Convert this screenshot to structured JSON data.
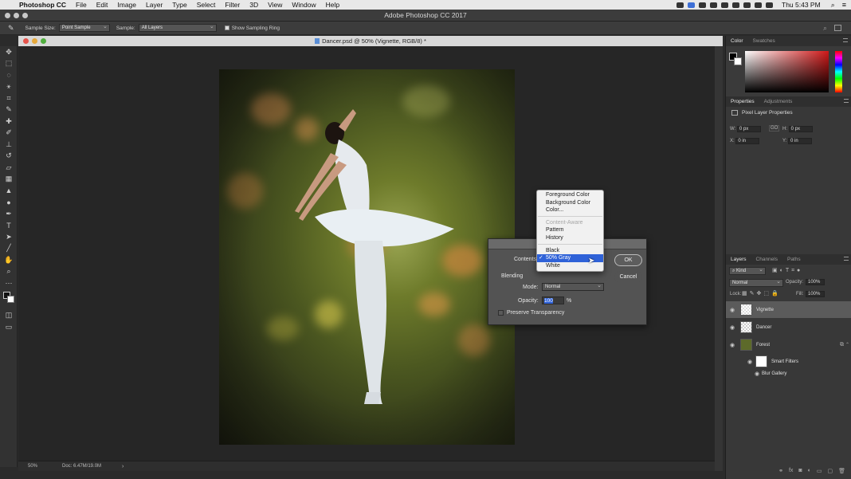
{
  "menubar": {
    "app": "Photoshop CC",
    "items": [
      "File",
      "Edit",
      "Image",
      "Layer",
      "Type",
      "Select",
      "Filter",
      "3D",
      "View",
      "Window",
      "Help"
    ],
    "clock": "Thu 5:43 PM"
  },
  "window": {
    "title": "Adobe Photoshop CC 2017"
  },
  "options": {
    "sample_size_label": "Sample Size:",
    "sample_size_value": "Point Sample",
    "sample_label": "Sample:",
    "sample_value": "All Layers",
    "sampling_ring_label": "Show Sampling Ring"
  },
  "document": {
    "tab_title": "Dancer.psd @ 50% (Vignette, RGB/8) *",
    "zoom": "50%",
    "doc_size": "Doc: 6.47M/19.0M"
  },
  "panels": {
    "color_tabs": [
      "Color",
      "Swatches"
    ],
    "properties_tabs": [
      "Properties",
      "Adjustments"
    ],
    "properties_title": "Pixel Layer Properties",
    "w_label": "W:",
    "w_value": "0 px",
    "h_label": "H:",
    "h_value": "0 px",
    "link_label": "GO",
    "x_label": "X:",
    "x_value": "0 in",
    "y_label": "Y:",
    "y_value": "0 in",
    "layers_tabs": [
      "Layers",
      "Channels",
      "Paths"
    ],
    "kind_value": "Kind",
    "blend_value": "Normal",
    "opacity_label": "Opacity:",
    "opacity_value": "100%",
    "lock_label": "Lock:",
    "fill_label": "Fill:",
    "fill_value": "100%",
    "layers": [
      {
        "name": "Vignette"
      },
      {
        "name": "Dancer"
      },
      {
        "name": "Forest"
      },
      {
        "name": "Smart Filters"
      },
      {
        "name": "Blur Gallery"
      }
    ]
  },
  "fill_dialog": {
    "contents_label": "Contents",
    "blending_label": "Blending",
    "mode_label": "Mode:",
    "mode_value": "Normal",
    "opacity_label": "Opacity:",
    "opacity_value": "100",
    "opacity_unit": "%",
    "preserve_label": "Preserve Transparency",
    "ok_label": "OK",
    "cancel_label": "Cancel"
  },
  "contents_menu": {
    "items": [
      {
        "label": "Foreground Color",
        "enabled": true
      },
      {
        "label": "Background Color",
        "enabled": true
      },
      {
        "label": "Color...",
        "enabled": true
      },
      {
        "label": "Content-Aware",
        "enabled": false
      },
      {
        "label": "Pattern",
        "enabled": true
      },
      {
        "label": "History",
        "enabled": true
      },
      {
        "label": "Black",
        "enabled": true
      },
      {
        "label": "50% Gray",
        "enabled": true,
        "selected": true
      },
      {
        "label": "White",
        "enabled": true
      }
    ],
    "check": "✓"
  },
  "colors": {
    "accent": "#2f62d8",
    "swatch_red": "#d01818"
  }
}
